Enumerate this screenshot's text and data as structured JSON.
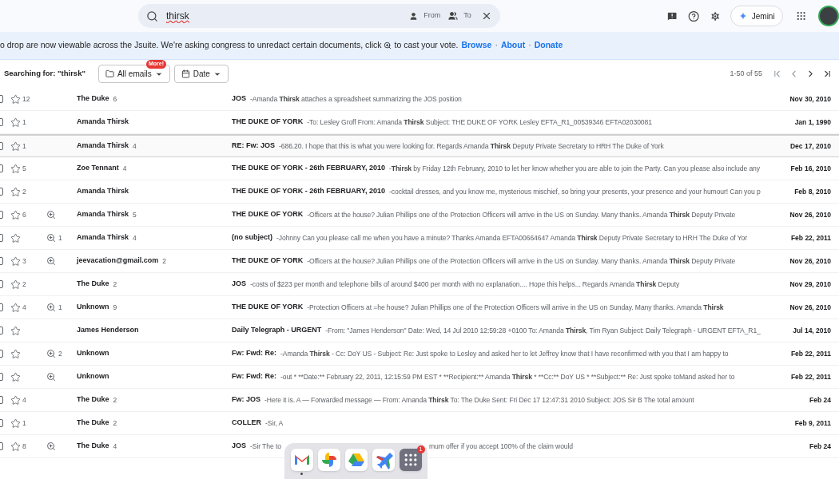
{
  "search": {
    "value": "thirsk",
    "from_label": "From",
    "to_label": "To"
  },
  "jemini": {
    "label": "Jemini"
  },
  "banner": {
    "text_before": "o drop are now viewable across the Jsuite. We're asking congress to unredact certain documents, click",
    "text_after": "to cast your vote.",
    "links": [
      "Browse",
      "About",
      "Donate"
    ],
    "separator": "·"
  },
  "toolbar": {
    "searching": "Searching for: \"thirsk\"",
    "filters": [
      {
        "kind": "folder",
        "label": "All emails",
        "badge": "More!"
      },
      {
        "kind": "calendar",
        "label": "Date"
      }
    ],
    "range": "1-50 of 55"
  },
  "rows": [
    {
      "checked": false,
      "selected": false,
      "stars": "12",
      "lens": false,
      "sender": "The Duke",
      "sender_count": "6",
      "subject": "JOS",
      "snippet": [
        {
          "text": "-Amanda ",
          "bold": false
        },
        {
          "text": "Thirsk",
          "bold": true
        },
        {
          "text": " attaches a spreadsheet summarizing the JOS position",
          "bold": false
        }
      ],
      "date": "Nov 30, 2010"
    },
    {
      "checked": false,
      "selected": false,
      "stars": "1",
      "lens": false,
      "sender": "Amanda Thirsk",
      "subject": "THE DUKE OF YORK",
      "snippet": [
        {
          "text": "-To: Lesley Groff From: Amanda ",
          "bold": false
        },
        {
          "text": "Thirsk",
          "bold": true
        },
        {
          "text": " Subject: THE DUKE OF YORK Lesley EFTA_R1_00539346 EFTA02030081",
          "bold": false
        }
      ],
      "date": "Jan 1, 1990"
    },
    {
      "checked": false,
      "selected": true,
      "stars": "1",
      "lens": false,
      "sender": "Amanda Thirsk",
      "sender_count": "4",
      "subject": "RE: Fw: JOS",
      "snippet": [
        {
          "text": "-686.20. I hope that this is what you were looking for. Regards Amanda ",
          "bold": false
        },
        {
          "text": "Thirsk",
          "bold": true
        },
        {
          "text": " Deputy Private Secretary to HRH The Duke of York",
          "bold": false
        }
      ],
      "date": "Dec 17, 2010"
    },
    {
      "checked": false,
      "selected": false,
      "stars": "5",
      "lens": false,
      "sender": "Zoe Tennant",
      "sender_count": "4",
      "subject": "THE DUKE OF YORK - 26th FEBRUARY, 2010",
      "snippet": [
        {
          "text": "-",
          "bold": false
        },
        {
          "text": "Thirsk",
          "bold": true
        },
        {
          "text": " by Friday 12th February, 2010 to let her know whether you are able to join the Party. Can you please also include any",
          "bold": false
        }
      ],
      "date": "Feb 16, 2010"
    },
    {
      "checked": false,
      "selected": false,
      "stars": "2",
      "lens": false,
      "sender": "Amanda Thirsk",
      "subject": "THE DUKE OF YORK - 26th FEBRUARY, 2010",
      "snippet": [
        {
          "text": "-cocktail dresses, and you know me, mysterious mischief, so bring your presents, your presence and your humour! Can you p",
          "bold": false
        }
      ],
      "date": "Feb 8, 2010"
    },
    {
      "checked": false,
      "selected": false,
      "stars": "6",
      "lens": true,
      "sender": "Amanda Thirsk",
      "sender_count": "5",
      "subject": "THE DUKE OF YORK",
      "snippet": [
        {
          "text": "-Officers at the house? Julian Phillips one of the Protection Officers will arrive in the US on Sunday. Many thanks. Amanda ",
          "bold": false
        },
        {
          "text": "Thirsk",
          "bold": true
        },
        {
          "text": " Deputy Private",
          "bold": false
        }
      ],
      "date": "Nov 26, 2010"
    },
    {
      "checked": false,
      "selected": false,
      "lens": true,
      "lens_count": "1",
      "sender": "Amanda Thirsk",
      "sender_count": "4",
      "subject": "(no subject)",
      "snippet": [
        {
          "text": "-Johnny Can you please call me when you have a minute? Thanks Amanda EFTA00664647 Amanda ",
          "bold": false
        },
        {
          "text": "Thirsk",
          "bold": true
        },
        {
          "text": " Deputy Private Secretary to HRH The Duke of Yor",
          "bold": false
        }
      ],
      "date": "Feb 22, 2011"
    },
    {
      "checked": false,
      "selected": false,
      "stars": "3",
      "lens": true,
      "sender": "jeevacation@gmail.com",
      "sender_count": "2",
      "subject": "THE DUKE OF YORK",
      "snippet": [
        {
          "text": "-Officers at the house? Julian Phillips one of the Protection Officers will arrive in the US on Sunday. Many thanks. Amanda ",
          "bold": false
        },
        {
          "text": "Thirsk",
          "bold": true
        },
        {
          "text": " Deputy Private",
          "bold": false
        }
      ],
      "date": "Nov 26, 2010"
    },
    {
      "checked": false,
      "selected": false,
      "stars": "2",
      "lens": false,
      "sender": "The Duke",
      "sender_count": "2",
      "subject": "JOS",
      "snippet": [
        {
          "text": "-costs of $223 per month and telephone bills of around $400 per month with no explanation.... Hope this helps... Regards Amanda ",
          "bold": false
        },
        {
          "text": "Thirsk",
          "bold": true
        },
        {
          "text": " Deputy",
          "bold": false
        }
      ],
      "date": "Nov 29, 2010"
    },
    {
      "checked": false,
      "selected": false,
      "stars": "4",
      "lens": true,
      "lens_count": "1",
      "sender": "Unknown",
      "sender_count": "9",
      "subject": "THE DUKE OF YORK",
      "snippet": [
        {
          "text": "-Protection Officers at =he house? Julian Phillips one of the Protection Officers will arrive in the US on Sunday. Many thanks. Amanda ",
          "bold": false
        },
        {
          "text": "Thirsk",
          "bold": true
        }
      ],
      "date": "Nov 26, 2010"
    },
    {
      "checked": false,
      "selected": false,
      "lens": false,
      "sender": "James Henderson",
      "subject": "Daily Telegraph - URGENT",
      "snippet": [
        {
          "text": "-From: \"James Henderson\" Date: Wed, 14 Jul 2010 12:59:28 +0100 To: Amanda ",
          "bold": false
        },
        {
          "text": "Thirsk",
          "bold": true
        },
        {
          "text": ", Tim Ryan Subject: Daily Telegraph - URGENT EFTA_R1_",
          "bold": false
        }
      ],
      "date": "Jul 14, 2010"
    },
    {
      "checked": false,
      "selected": false,
      "lens": true,
      "lens_count": "2",
      "sender": "Unknown",
      "subject": "Fw: Fwd: Re:",
      "snippet": [
        {
          "text": "-Amanda ",
          "bold": false
        },
        {
          "text": "Thirsk",
          "bold": true
        },
        {
          "text": " - Cc: DoY US - Subject: Re: Just spoke to Lesley and asked her to let Jeffrey know that I have reconfirmed with you that I am happy to",
          "bold": false
        }
      ],
      "date": "Feb 22, 2011"
    },
    {
      "checked": false,
      "selected": false,
      "lens": true,
      "sender": "Unknown",
      "subject": "Fw: Fwd: Re:",
      "snippet": [
        {
          "text": "-out * **Date:** February 22, 2011, 12:15:59 PM EST * **Recipient:** Amanda ",
          "bold": false
        },
        {
          "text": "Thirsk",
          "bold": true
        },
        {
          "text": " * **Cc:** DoY US * **Subject:** Re: Just spoke toMand asked her to",
          "bold": false
        }
      ],
      "date": "Feb 22, 2011"
    },
    {
      "checked": false,
      "selected": false,
      "stars": "4",
      "lens": false,
      "sender": "The Duke",
      "sender_count": "2",
      "subject": "Fw: JOS",
      "snippet": [
        {
          "text": "-Here it is. A — Forwarded message — From: Amanda ",
          "bold": false
        },
        {
          "text": "Thirsk",
          "bold": true
        },
        {
          "text": " To: The Duke Sent: Fri Dec 17 12:47:31 2010 Subject: JOS Sir B The total amount",
          "bold": false
        }
      ],
      "date": "Feb 24"
    },
    {
      "checked": false,
      "selected": false,
      "stars": "1",
      "lens": false,
      "sender": "The Duke",
      "sender_count": "2",
      "subject": "COLLER",
      "snippet": [
        {
          "text": "-Sir, A",
          "bold": false
        }
      ],
      "date": "Feb 9, 2011"
    },
    {
      "checked": false,
      "selected": false,
      "stars": "8",
      "lens": true,
      "sender": "The Duke",
      "sender_count": "4",
      "subject": "JOS",
      "snippet": [
        {
          "text": "-Sir The to",
          "bold": false
        }
      ],
      "snippet_tail": "mum offer if you accept 100% of the claim would",
      "date": "Feb 24"
    }
  ],
  "dock": [
    {
      "kind": "mail",
      "running": true
    },
    {
      "kind": "pinwheel",
      "running": false
    },
    {
      "kind": "drive",
      "running": false
    },
    {
      "kind": "plane",
      "running": false
    },
    {
      "kind": "apps",
      "running": false,
      "badge": "1"
    }
  ]
}
